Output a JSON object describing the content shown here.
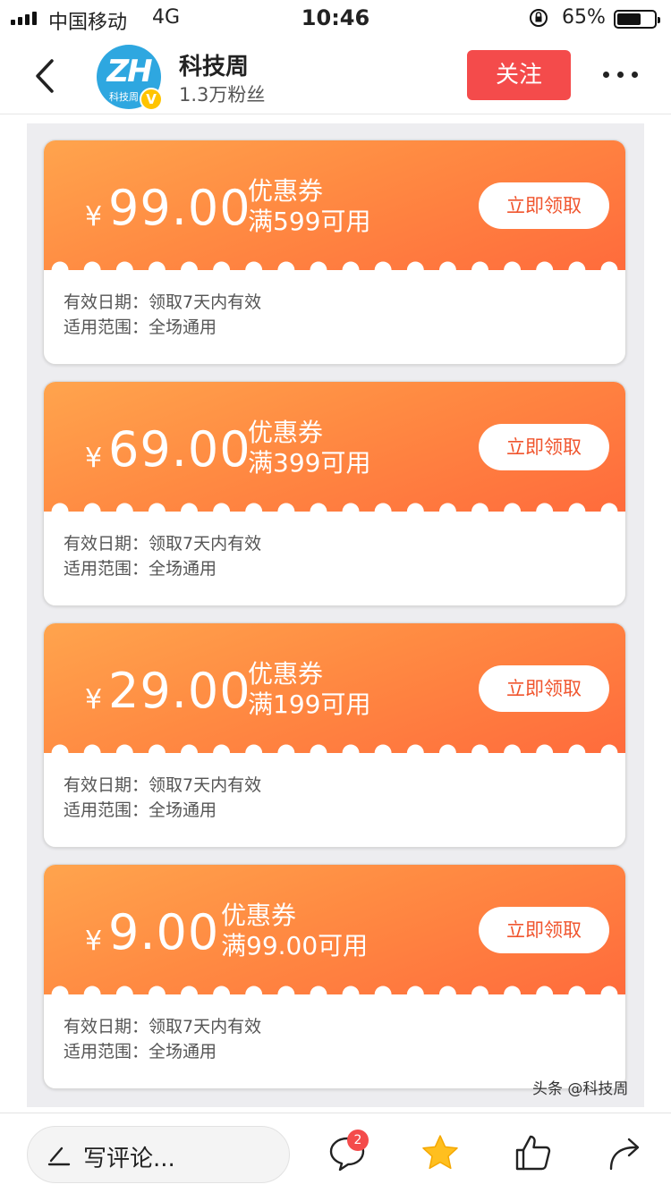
{
  "status_bar": {
    "carrier": "中国移动",
    "network": "4G",
    "time": "10:46",
    "battery": "65%",
    "battery_level": 0.65
  },
  "nav": {
    "account_name": "科技周",
    "followers": "1.3万粉丝",
    "follow_label": "关注",
    "avatar_logo": "ZH",
    "avatar_sub": "科技周",
    "verified_mark": "V"
  },
  "coupons": [
    {
      "currency": "¥",
      "amount": "99.00",
      "title": "优惠券",
      "condition": "满599可用",
      "claim_label": "立即领取",
      "validity": "有效日期：领取7天内有效",
      "scope": "适用范围：全场通用"
    },
    {
      "currency": "¥",
      "amount": "69.00",
      "title": "优惠券",
      "condition": "满399可用",
      "claim_label": "立即领取",
      "validity": "有效日期：领取7天内有效",
      "scope": "适用范围：全场通用"
    },
    {
      "currency": "¥",
      "amount": "29.00",
      "title": "优惠券",
      "condition": "满199可用",
      "claim_label": "立即领取",
      "validity": "有效日期：领取7天内有效",
      "scope": "适用范围：全场通用"
    },
    {
      "currency": "¥",
      "amount": "9.00",
      "title": "优惠券",
      "condition": "满99.00可用",
      "claim_label": "立即领取",
      "validity": "有效日期：领取7天内有效",
      "scope": "适用范围：全场通用"
    }
  ],
  "watermark": "头条 @科技周",
  "bottom_bar": {
    "comment_placeholder": "写评论...",
    "comment_count": "2"
  },
  "colors": {
    "accent_red": "#f44b4b",
    "coupon_orange": "#ff8a42",
    "star_yellow": "#ffbf1f"
  }
}
